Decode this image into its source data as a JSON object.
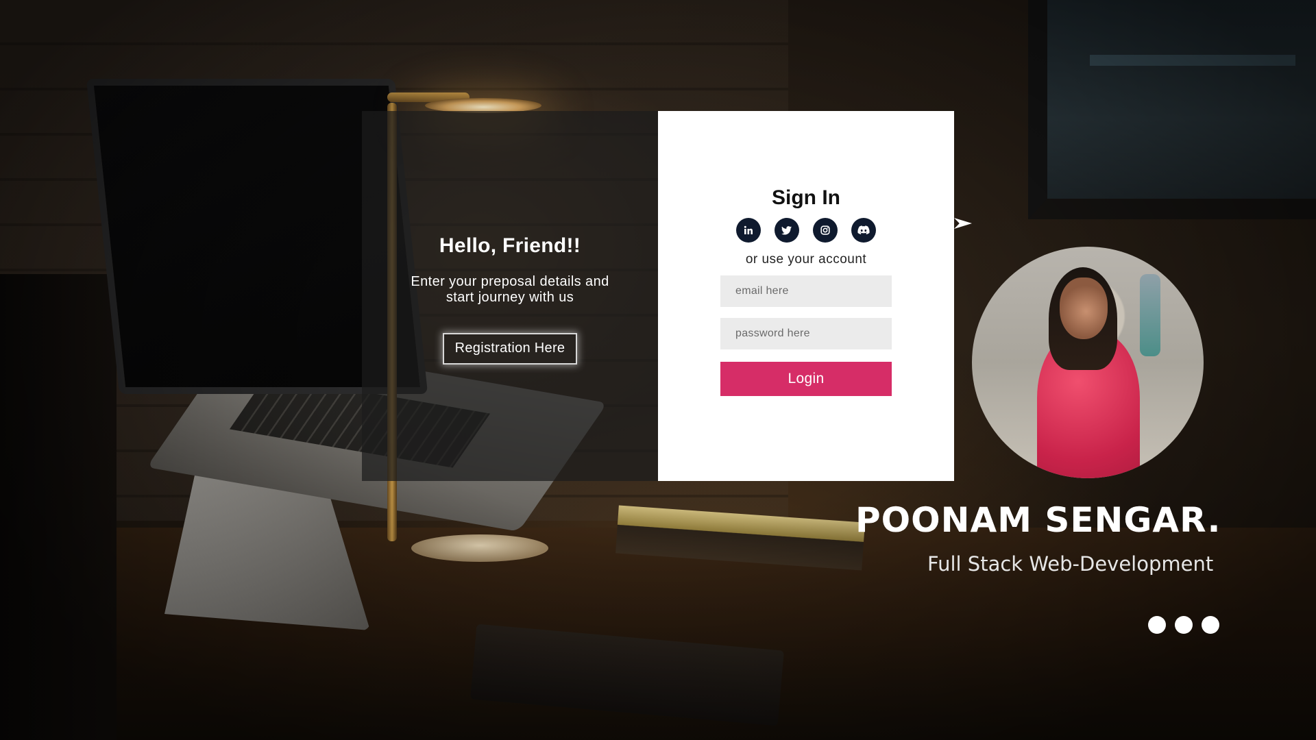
{
  "overlay": {
    "title": "Hello, Friend!!",
    "text": "Enter your preposal details and start journey with us",
    "register_label": "Registration Here"
  },
  "signin": {
    "title": "Sign In",
    "social_icons": [
      "linkedin-icon",
      "twitter-icon",
      "instagram-icon",
      "discord-icon"
    ],
    "alt_text": "or use your account",
    "email_placeholder": "email here",
    "password_placeholder": "password here",
    "login_label": "Login"
  },
  "profile": {
    "name": "POONAM SENGAR.",
    "role": "Full Stack Web-Development",
    "dots_count": 3
  },
  "colors": {
    "login_button": "#d62d67",
    "social_icon_bg": "#0f1a2e",
    "signin_panel": "#ffffff",
    "overlay_panel": "rgba(28,28,28,0.72)",
    "input_bg": "#ebebeb"
  }
}
